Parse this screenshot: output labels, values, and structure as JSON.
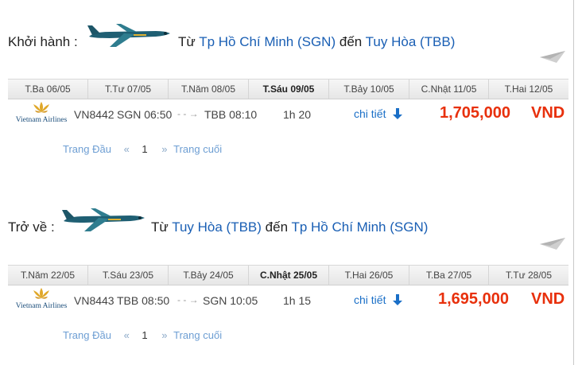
{
  "outbound": {
    "label": "Khởi hành :",
    "route_prefix": "Từ",
    "from_city": "Tp Hồ Chí Minh (SGN)",
    "route_mid": "đến",
    "to_city": "Tuy Hòa (TBB)",
    "dates": [
      "T.Ba 06/05",
      "T.Tư 07/05",
      "T.Năm 08/05",
      "T.Sáu 09/05",
      "T.Bảy 10/05",
      "C.Nhật 11/05",
      "T.Hai 12/05"
    ],
    "active_date_index": 3,
    "flight": {
      "airline": "Vietnam Airlines",
      "flight_no": "VN8442",
      "dep": "SGN 06:50",
      "arr": "TBB 08:10",
      "duration": "1h 20",
      "detail_label": "chi tiết",
      "price": "1,705,000",
      "currency": "VND"
    },
    "pager": {
      "first": "Trang Đầu",
      "prev": "«",
      "page": "1",
      "next": "»",
      "last": "Trang cuối"
    }
  },
  "return": {
    "label": "Trở về :",
    "route_prefix": "Từ",
    "from_city": "Tuy Hòa (TBB)",
    "route_mid": "đến",
    "to_city": "Tp Hồ Chí Minh (SGN)",
    "dates": [
      "T.Năm 22/05",
      "T.Sáu 23/05",
      "T.Bảy 24/05",
      "C.Nhật 25/05",
      "T.Hai 26/05",
      "T.Ba 27/05",
      "T.Tư 28/05"
    ],
    "active_date_index": 3,
    "flight": {
      "airline": "Vietnam Airlines",
      "flight_no": "VN8443",
      "dep": "TBB 08:50",
      "arr": "SGN 10:05",
      "duration": "1h 15",
      "detail_label": "chi tiết",
      "price": "1,695,000",
      "currency": "VND"
    },
    "pager": {
      "first": "Trang Đầu",
      "prev": "«",
      "page": "1",
      "next": "»",
      "last": "Trang cuối"
    }
  },
  "colors": {
    "link": "#1a5fb4",
    "price": "#e8300c",
    "pager": "#6d9ed3"
  },
  "icons": [
    "airplane-image",
    "paper-plane-icon",
    "vietnam-airlines-logo",
    "arrow-right-icon",
    "arrow-down-icon"
  ]
}
